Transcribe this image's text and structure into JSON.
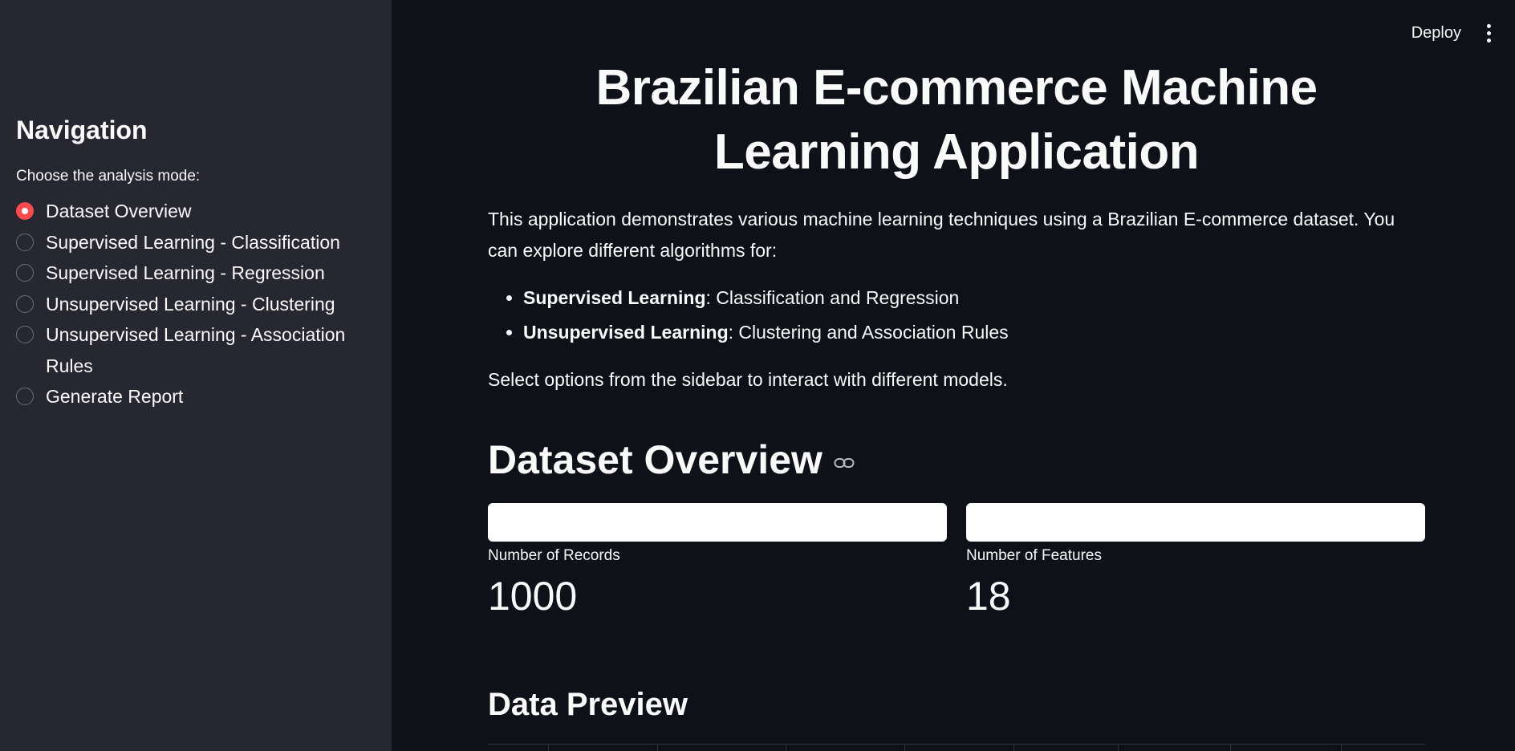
{
  "sidebar": {
    "title": "Navigation",
    "radio_label": "Choose the analysis mode:",
    "options": [
      {
        "label": "Dataset Overview",
        "selected": true
      },
      {
        "label": "Supervised Learning - Classification",
        "selected": false
      },
      {
        "label": "Supervised Learning - Regression",
        "selected": false
      },
      {
        "label": "Unsupervised Learning - Clustering",
        "selected": false
      },
      {
        "label": "Unsupervised Learning - Association Rules",
        "selected": false
      },
      {
        "label": "Generate Report",
        "selected": false
      }
    ]
  },
  "toolbar": {
    "deploy_label": "Deploy",
    "menu_icon": "vertical-ellipsis-icon"
  },
  "main": {
    "title": "Brazilian E-commerce Machine Learning Application",
    "intro": "This application demonstrates various machine learning techniques using a Brazilian E-commerce dataset. You can explore different algorithms for:",
    "bullets": [
      {
        "bold": "Supervised Learning",
        "rest": ": Classification and Regression"
      },
      {
        "bold": "Unsupervised Learning",
        "rest": ": Clustering and Association Rules"
      }
    ],
    "select_note": "Select options from the sidebar to interact with different models.",
    "section_heading": "Dataset Overview",
    "metrics": [
      {
        "label": "Number of Records",
        "value": "1000"
      },
      {
        "label": "Number of Features",
        "value": "18"
      }
    ],
    "subheading": "Data Preview"
  },
  "colors": {
    "background": "#0e1117",
    "sidebar": "#262730",
    "accent": "#ff4b4b",
    "text": "#fafafa"
  }
}
